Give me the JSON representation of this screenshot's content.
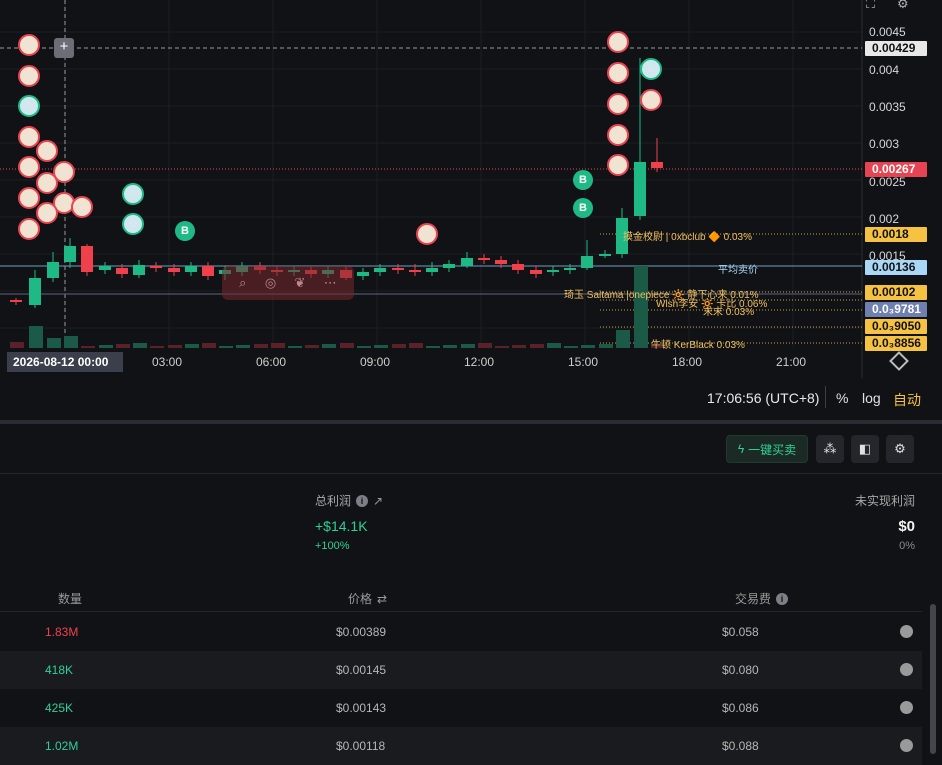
{
  "chart": {
    "price_axis": [
      "0.0045",
      "0.004",
      "0.0035",
      "0.003",
      "0.0025",
      "0.002",
      "0.0015"
    ],
    "crosshair_price": "0.00429",
    "current_price": "0.00267",
    "price_tags": [
      {
        "value": "0.0018",
        "bg": "#f5c242",
        "color": "#111"
      },
      {
        "value": "0.00136",
        "bg": "#a9d7f5",
        "color": "#111"
      },
      {
        "value": "0.00102",
        "bg": "#f5c242",
        "color": "#111"
      },
      {
        "value": "0.0₃9781",
        "bg": "#6e7fb0",
        "color": "#fff"
      },
      {
        "value": "0.0₃9050",
        "bg": "#f5c242",
        "color": "#111"
      },
      {
        "value": "0.0₃8856",
        "bg": "#f5c242",
        "color": "#111"
      }
    ],
    "line_labels": [
      {
        "text": "摸金校尉 | 0xbclub 🔶 0.03%"
      },
      {
        "text": "平均卖价"
      },
      {
        "text": "琦玉 Saitama |onepiece 🔆 静下心来 0.01%"
      },
      {
        "text": "Wlsh李安 🔆 卡比 0.06%"
      },
      {
        "text": "末末 0.03%"
      },
      {
        "text": "牛顿 KerBlack 0.03%"
      }
    ],
    "time_axis": {
      "current": "2026-08-12   00:00",
      "ticks": [
        "03:00",
        "06:00",
        "09:00",
        "12:00",
        "15:00",
        "18:00",
        "21:00"
      ]
    },
    "badge_label": "B",
    "clock": "17:06:56 (UTC+8)",
    "mode_percent": "%",
    "mode_log": "log",
    "mode_auto": "自动",
    "colors": {
      "up": "#1fb985",
      "down": "#f0404c",
      "accent": "#f5c242"
    }
  },
  "panel": {
    "quick_buy_label": "一键买卖",
    "total_profit_label": "总利润",
    "total_profit_value": "+$14.1K",
    "total_profit_pct": "+100%",
    "unrealized_label": "未实现利润",
    "unrealized_value": "$0",
    "unrealized_pct": "0%",
    "table": {
      "headers": {
        "qty": "数量",
        "price": "价格",
        "fee": "交易费"
      },
      "rows": [
        {
          "qty": "1.83M",
          "side": "sell",
          "price": "$0.00389",
          "fee": "$0.058"
        },
        {
          "qty": "418K",
          "side": "buy",
          "price": "$0.00145",
          "fee": "$0.080"
        },
        {
          "qty": "425K",
          "side": "buy",
          "price": "$0.00143",
          "fee": "$0.086"
        },
        {
          "qty": "1.02M",
          "side": "buy",
          "price": "$0.00118",
          "fee": "$0.088"
        }
      ]
    }
  }
}
